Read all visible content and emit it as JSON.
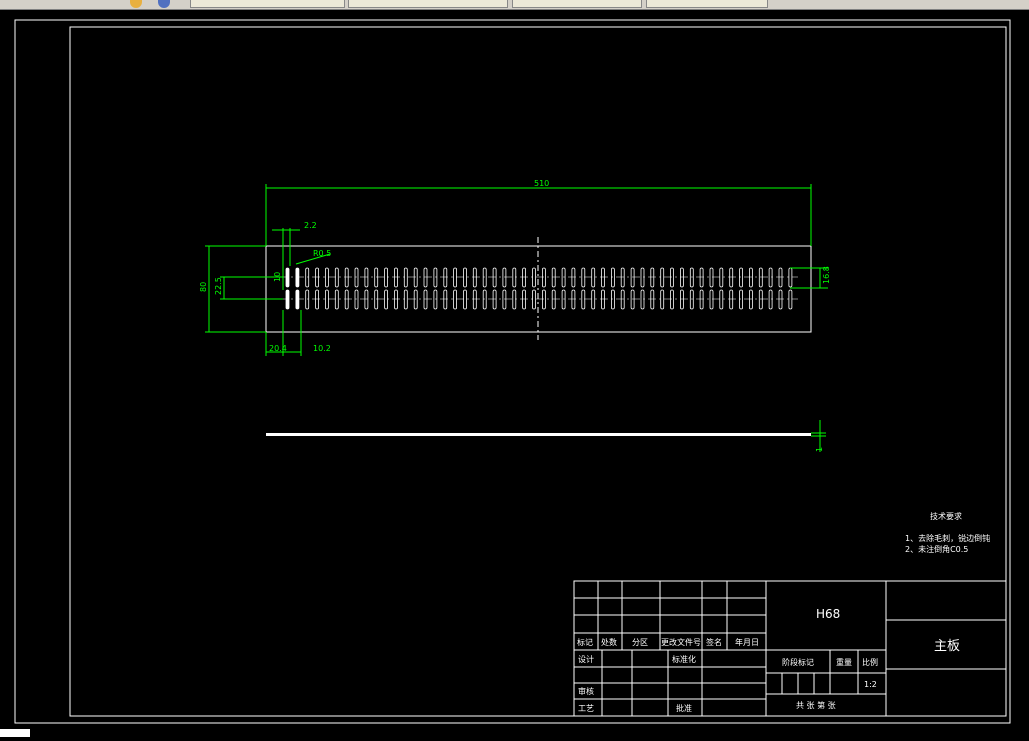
{
  "drawing": {
    "dim_overall_length": "510",
    "dim_slot_width": "2.2",
    "dim_radius": "R0.5",
    "dim_overall_height": "80",
    "dim_row_spacing": "22.5",
    "dim_slot_small": "10",
    "dim_left_offset": "20.4",
    "dim_pitch": "10.2",
    "dim_slot_length": "16.8",
    "dim_thickness": "1"
  },
  "notes": {
    "title": "技术要求",
    "lines": [
      "1、去除毛刺，锐边倒钝",
      "2、未注倒角C0.5"
    ]
  },
  "title_block": {
    "material": "H68",
    "part_name": "主板",
    "col_headers": [
      "标记",
      "处数",
      "分区",
      "更改文件号",
      "签名",
      "年月日"
    ],
    "row_design": "设计",
    "row_standard": "标准化",
    "row_review": "审核",
    "row_process": "工艺",
    "row_approve": "批准",
    "stage_label": "阶段标记",
    "weight_label": "重量",
    "scale_label": "比例",
    "scale_value": "1:2",
    "sheets_label": "共 张 第 张"
  },
  "colors": {
    "drawing_lines": "#ffffff",
    "dimension_lines": "#00ff00",
    "background": "#000000"
  }
}
